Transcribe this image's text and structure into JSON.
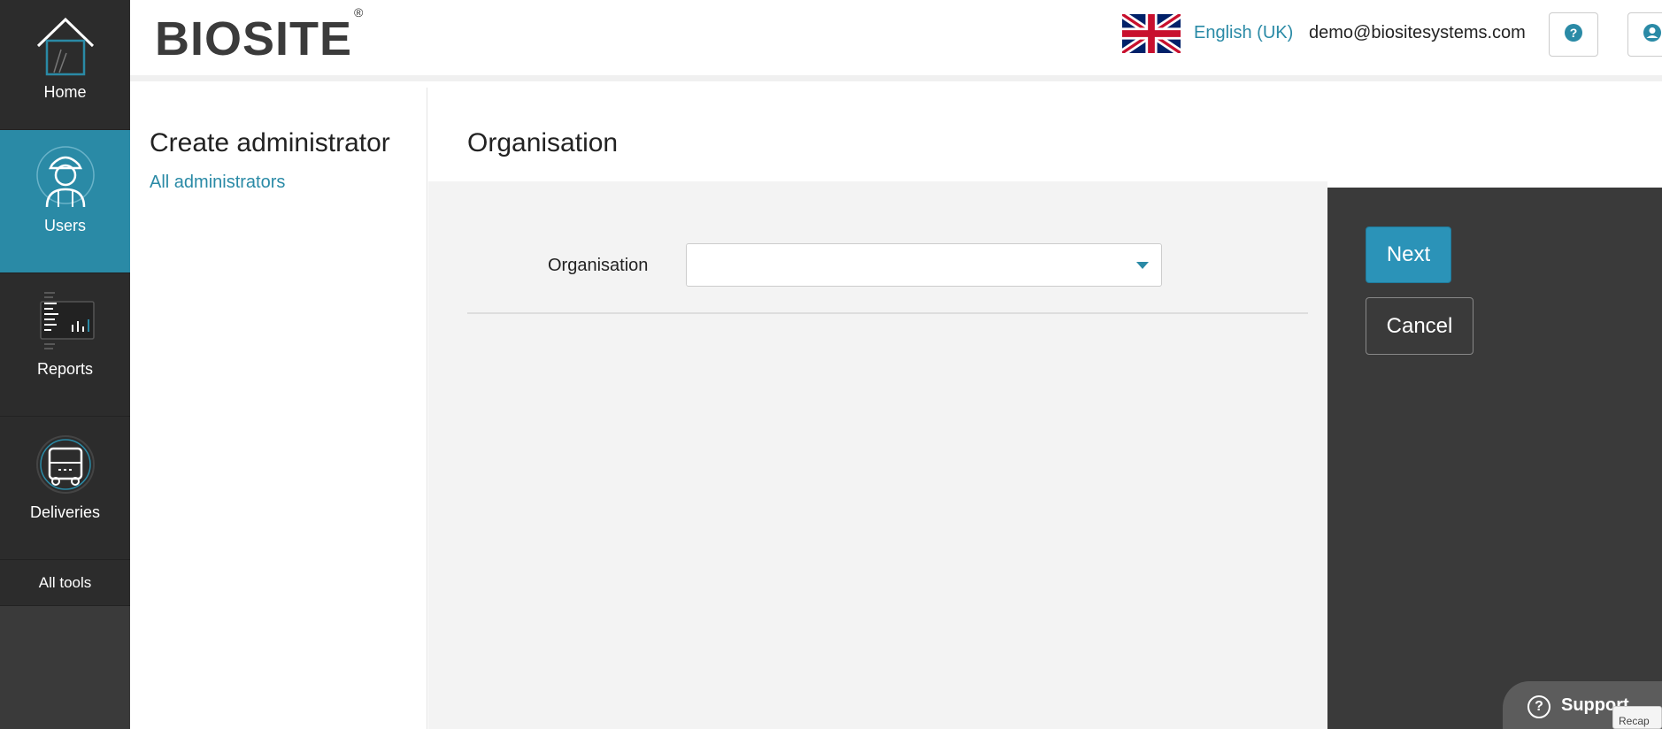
{
  "nav": {
    "items": [
      {
        "label": "Home",
        "icon": "house-icon"
      },
      {
        "label": "Users",
        "icon": "worker-icon"
      },
      {
        "label": "Reports",
        "icon": "report-icon"
      },
      {
        "label": "Deliveries",
        "icon": "truck-icon"
      }
    ],
    "all_tools": "All tools",
    "active_color": "#2a8aa6"
  },
  "header": {
    "logo": "BIOSITE",
    "logo_mark": "®",
    "language": "English (UK)",
    "email": "demo@biositesystems.com",
    "help_icon": "question-circle-icon",
    "user_icon": "user-circle-icon"
  },
  "left_panel": {
    "title": "Create administrator",
    "link": "All administrators"
  },
  "main": {
    "title": "Organisation",
    "field_label": "Organisation",
    "field_value": ""
  },
  "actions": {
    "next": "Next",
    "cancel": "Cancel"
  },
  "support": {
    "label": "Support",
    "recaptcha_text": "Recap"
  },
  "colors": {
    "accent": "#2a8aa6",
    "button_primary": "#2b93b8",
    "sidebar_bg": "#2c2c2c",
    "action_panel_bg": "#3a3a3a"
  }
}
